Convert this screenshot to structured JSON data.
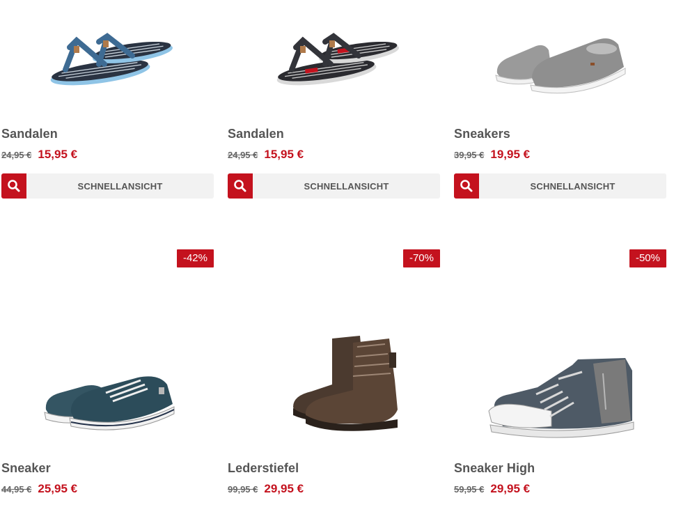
{
  "quickview_label": "SCHNELLANSICHT",
  "accent_color": "#c4121e",
  "products": [
    {
      "name": "Sandalen",
      "old_price": "24,95 €",
      "new_price": "15,95 €",
      "image": "flip-flop-blue"
    },
    {
      "name": "Sandalen",
      "old_price": "24,95 €",
      "new_price": "15,95 €",
      "image": "flip-flop-red"
    },
    {
      "name": "Sneakers",
      "old_price": "39,95 €",
      "new_price": "19,95 €",
      "image": "slip-on-grey"
    },
    {
      "name": "Sneaker",
      "old_price": "44,95 €",
      "new_price": "25,95 €",
      "discount": "-42%",
      "image": "sneaker-teal"
    },
    {
      "name": "Lederstiefel",
      "old_price": "99,95 €",
      "new_price": "29,95 €",
      "discount": "-70%",
      "image": "boot-brown"
    },
    {
      "name": "Sneaker High",
      "old_price": "59,95 €",
      "new_price": "29,95 €",
      "discount": "-50%",
      "image": "high-top-grey"
    }
  ]
}
